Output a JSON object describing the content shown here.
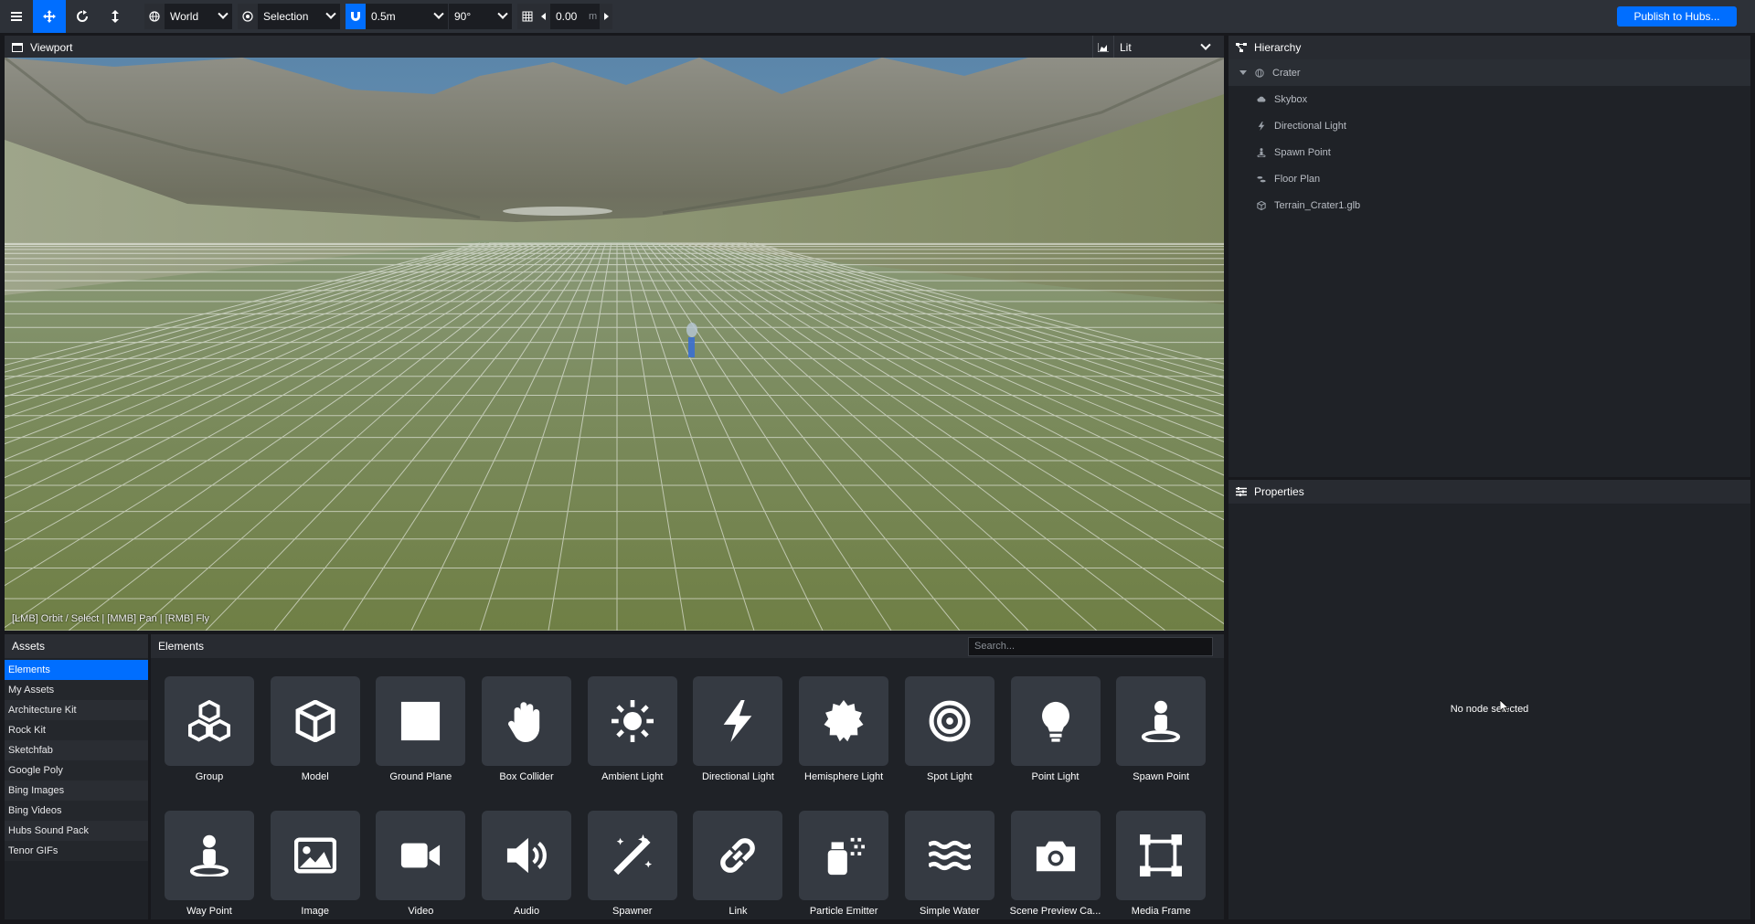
{
  "toolbar": {
    "space": "World",
    "pivot": "Selection",
    "snap_translate": "0.5m",
    "snap_rotate": "90°",
    "grid_height": "0.00",
    "grid_unit": "m",
    "publish_label": "Publish to Hubs..."
  },
  "viewport": {
    "title": "Viewport",
    "render_mode": "Lit",
    "hint": "[LMB] Orbit / Select | [MMB] Pan | [RMB] Fly"
  },
  "hierarchy": {
    "title": "Hierarchy",
    "root": "Crater",
    "items": [
      {
        "label": "Skybox",
        "icon": "cloud-icon"
      },
      {
        "label": "Directional Light",
        "icon": "bolt-icon"
      },
      {
        "label": "Spawn Point",
        "icon": "street-view-icon"
      },
      {
        "label": "Floor Plan",
        "icon": "shoe-prints-icon"
      },
      {
        "label": "Terrain_Crater1.glb",
        "icon": "cube-icon"
      }
    ]
  },
  "properties": {
    "title": "Properties",
    "empty_text": "No node selected"
  },
  "assets": {
    "title": "Assets",
    "items": [
      "Elements",
      "My Assets",
      "Architecture Kit",
      "Rock Kit",
      "Sketchfab",
      "Google Poly",
      "Bing Images",
      "Bing Videos",
      "Hubs Sound Pack",
      "Tenor GIFs"
    ]
  },
  "elements": {
    "title": "Elements",
    "search_placeholder": "Search...",
    "items": [
      {
        "label": "Group",
        "icon": "cubes-icon"
      },
      {
        "label": "Model",
        "icon": "cube-icon"
      },
      {
        "label": "Ground Plane",
        "icon": "square-icon"
      },
      {
        "label": "Box Collider",
        "icon": "hand-icon"
      },
      {
        "label": "Ambient Light",
        "icon": "sun-icon"
      },
      {
        "label": "Directional Light",
        "icon": "bolt-icon"
      },
      {
        "label": "Hemisphere Light",
        "icon": "certificate-icon"
      },
      {
        "label": "Spot Light",
        "icon": "bullseye-icon"
      },
      {
        "label": "Point Light",
        "icon": "lightbulb-icon"
      },
      {
        "label": "Spawn Point",
        "icon": "street-view-icon"
      },
      {
        "label": "Way Point",
        "icon": "street-view-icon"
      },
      {
        "label": "Image",
        "icon": "image-icon"
      },
      {
        "label": "Video",
        "icon": "video-icon"
      },
      {
        "label": "Audio",
        "icon": "volume-icon"
      },
      {
        "label": "Spawner",
        "icon": "magic-icon"
      },
      {
        "label": "Link",
        "icon": "link-icon"
      },
      {
        "label": "Particle Emitter",
        "icon": "spray-can-icon"
      },
      {
        "label": "Simple Water",
        "icon": "water-icon"
      },
      {
        "label": "Scene Preview Ca...",
        "icon": "camera-icon"
      },
      {
        "label": "Media Frame",
        "icon": "vector-square-icon"
      }
    ]
  }
}
